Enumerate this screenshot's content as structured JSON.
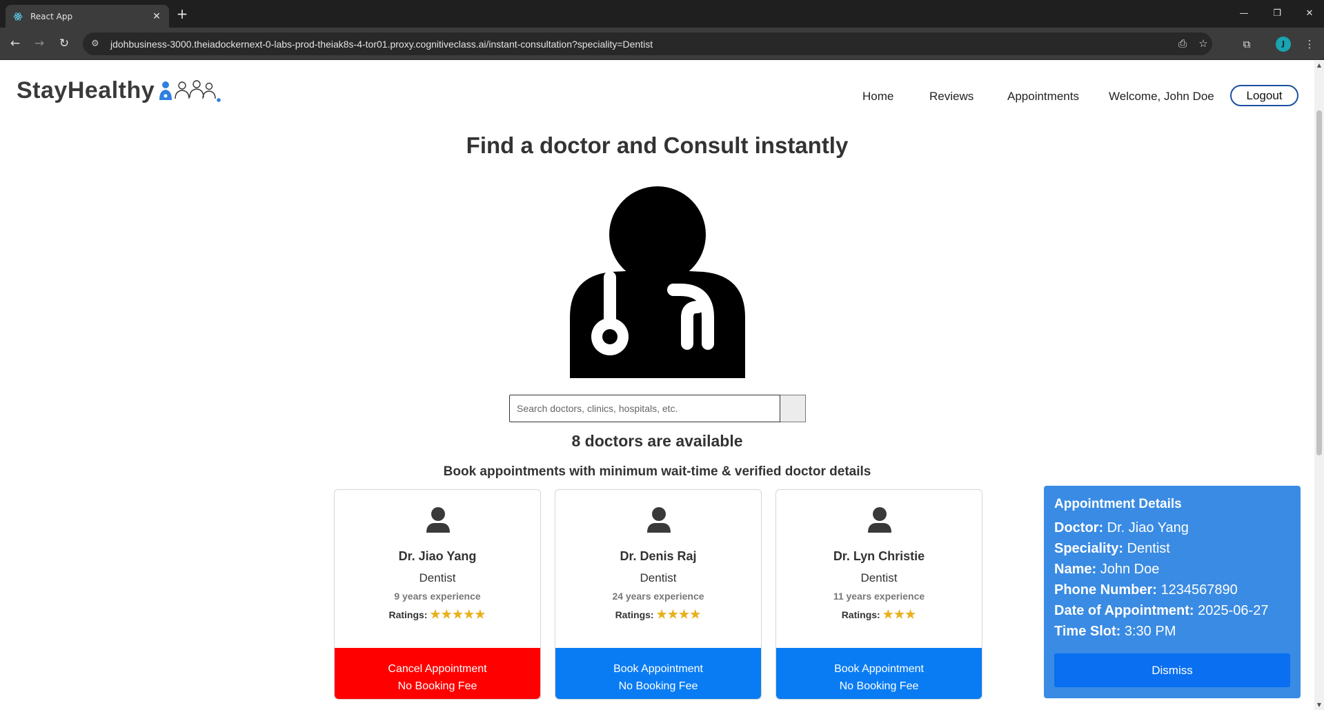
{
  "browser": {
    "tab_title": "React App",
    "url": "jdohbusiness-3000.theiadockernext-0-labs-prod-theiak8s-4-tor01.proxy.cognitiveclass.ai/instant-consultation?speciality=Dentist",
    "profile_initial": "J"
  },
  "brand": {
    "name": "StayHealthy",
    "color": "#3a3a3a",
    "logo_accent": "#2f7fe0"
  },
  "nav": {
    "home": "Home",
    "reviews": "Reviews",
    "appointments": "Appointments",
    "welcome": "Welcome, John Doe",
    "logout": "Logout"
  },
  "main": {
    "heading": "Find a doctor and Consult instantly",
    "search_placeholder": "Search doctors, clinics, hospitals, etc.",
    "search_value": "",
    "available": "8 doctors are available",
    "subheading": "Book appointments with minimum wait-time & verified doctor details"
  },
  "doctors": [
    {
      "name": "Dr. Jiao Yang",
      "speciality": "Dentist",
      "experience": "9 years experience",
      "ratings_label": "Ratings:",
      "stars": 5,
      "stars_text": "★★★★★",
      "action_line1": "Cancel Appointment",
      "action_line2": "No Booking Fee",
      "action_type": "cancel"
    },
    {
      "name": "Dr. Denis Raj",
      "speciality": "Dentist",
      "experience": "24 years experience",
      "ratings_label": "Ratings:",
      "stars": 4,
      "stars_text": "★★★★",
      "action_line1": "Book Appointment",
      "action_line2": "No Booking Fee",
      "action_type": "book"
    },
    {
      "name": "Dr. Lyn Christie",
      "speciality": "Dentist",
      "experience": "11 years experience",
      "ratings_label": "Ratings:",
      "stars": 3,
      "stars_text": "★★★",
      "action_line1": "Book Appointment",
      "action_line2": "No Booking Fee",
      "action_type": "book"
    }
  ],
  "appointment": {
    "title": "Appointment Details",
    "doctor_label": "Doctor:",
    "doctor": "Dr. Jiao Yang",
    "speciality_label": "Speciality:",
    "speciality": "Dentist",
    "name_label": "Name:",
    "name": "John Doe",
    "phone_label": "Phone Number:",
    "phone": "1234567890",
    "date_label": "Date of Appointment:",
    "date": "2025-06-27",
    "slot_label": "Time Slot:",
    "slot": "3:30 PM",
    "dismiss": "Dismiss"
  },
  "colors": {
    "cancel": "#ff0000",
    "book": "#0a7cf3",
    "panel": "#3a8be3",
    "star": "#e8b01c"
  },
  "icons": [
    "react-icon",
    "close-icon",
    "plus-icon",
    "back-icon",
    "forward-icon",
    "reload-icon",
    "site-info-icon",
    "install-icon",
    "bookmark-star-icon",
    "tab-search-icon",
    "menu-icon",
    "doctor-icon",
    "user-avatar-icon"
  ]
}
